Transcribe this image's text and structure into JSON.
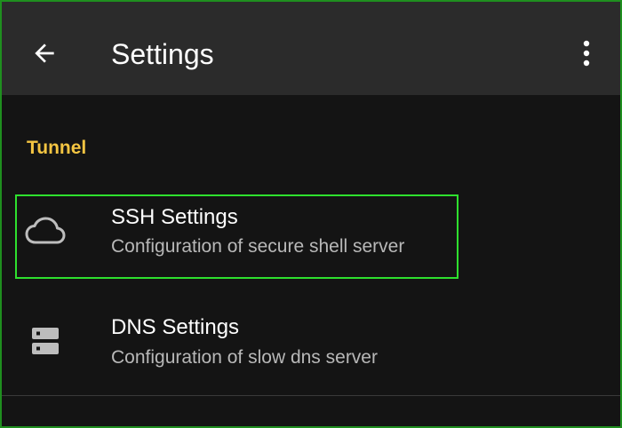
{
  "appbar": {
    "title": "Settings",
    "back_icon": "arrow-back-icon",
    "menu_icon": "more-vert-icon"
  },
  "section": {
    "header": "Tunnel"
  },
  "items": [
    {
      "title": "SSH Settings",
      "subtitle": "Configuration of secure shell server",
      "icon": "cloud-icon",
      "highlighted": true
    },
    {
      "title": "DNS Settings",
      "subtitle": "Configuration of slow dns server",
      "icon": "server-icon",
      "highlighted": false
    }
  ],
  "colors": {
    "accent": "#f4c542",
    "highlight": "#2ee02e",
    "background": "#141414",
    "appbar": "#2b2b2b"
  }
}
